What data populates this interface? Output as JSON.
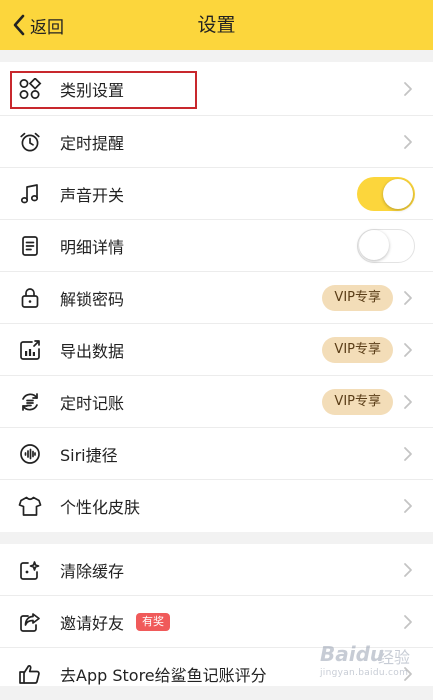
{
  "nav": {
    "back_label": "返回",
    "title": "设置"
  },
  "settings": [
    {
      "id": "category",
      "icon": "grid-icon",
      "label": "类别设置",
      "accessory": "chevron"
    },
    {
      "id": "reminder",
      "icon": "alarm-clock-icon",
      "label": "定时提醒",
      "accessory": "chevron"
    },
    {
      "id": "sound",
      "icon": "music-note-icon",
      "label": "声音开关",
      "accessory": "toggle",
      "toggle_on": true
    },
    {
      "id": "details",
      "icon": "list-icon",
      "label": "明细详情",
      "accessory": "toggle",
      "toggle_on": false
    },
    {
      "id": "unlock",
      "icon": "lock-icon",
      "label": "解锁密码",
      "accessory": "vip",
      "vip_label": "VIP专享"
    },
    {
      "id": "export",
      "icon": "export-chart-icon",
      "label": "导出数据",
      "accessory": "vip",
      "vip_label": "VIP专享"
    },
    {
      "id": "auto-record",
      "icon": "cycle-icon",
      "label": "定时记账",
      "accessory": "vip",
      "vip_label": "VIP专享"
    },
    {
      "id": "siri",
      "icon": "siri-icon",
      "label": "Siri捷径",
      "accessory": "chevron"
    },
    {
      "id": "skin",
      "icon": "tshirt-icon",
      "label": "个性化皮肤",
      "accessory": "chevron"
    }
  ],
  "more": [
    {
      "id": "clear-cache",
      "icon": "sparkle-icon",
      "label": "清除缓存",
      "accessory": "chevron"
    },
    {
      "id": "invite",
      "icon": "share-icon",
      "label": "邀请好友",
      "accessory": "chevron",
      "badge": "有奖"
    },
    {
      "id": "rate",
      "icon": "thumbs-up-icon",
      "label": "去App Store给鲨鱼记账评分",
      "accessory": "chevron"
    }
  ],
  "watermark": {
    "brand": "Baidu",
    "sub": "经验",
    "url": "jingyan.baidu.com"
  },
  "colors": {
    "accent": "#fcd63c",
    "vip_bg": "#f3ddb8",
    "vip_text": "#5a3d17",
    "badge": "#f05a5a",
    "highlight": "#c8282d"
  }
}
